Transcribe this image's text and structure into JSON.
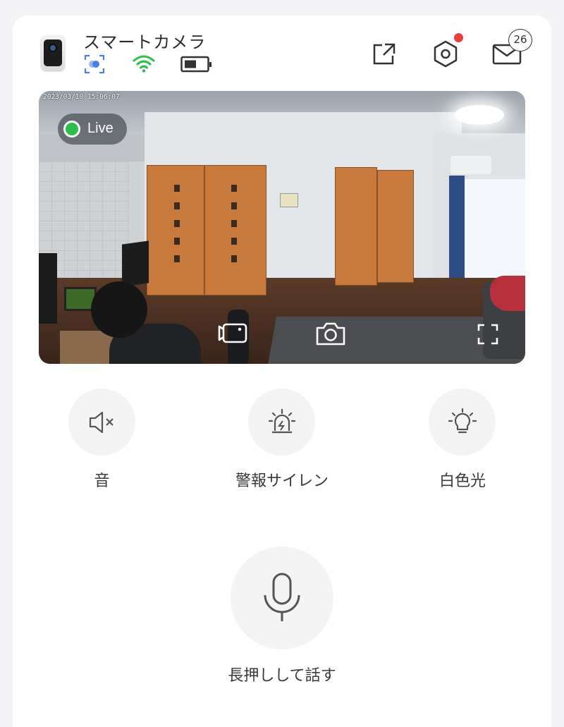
{
  "header": {
    "title": "スマートカメラ",
    "camera_icon": "camera-device-icon",
    "status_icons": [
      "motion-detect-icon",
      "wifi-icon",
      "battery-icon"
    ],
    "actions": [
      "share-icon",
      "settings-icon",
      "mail-icon"
    ],
    "settings_has_alert": true,
    "mail_count": "26"
  },
  "video": {
    "timestamp": "2023/03/10 15:06:07",
    "live_label": "Live",
    "controls": [
      "record-icon",
      "snapshot-icon",
      "fullscreen-icon"
    ]
  },
  "controls": [
    {
      "label": "音",
      "icon": "speaker-muted-icon"
    },
    {
      "label": "警報サイレン",
      "icon": "siren-icon"
    },
    {
      "label": "白色光",
      "icon": "light-bulb-icon"
    }
  ],
  "talk": {
    "label": "長押しして話す",
    "icon": "microphone-icon"
  },
  "colors": {
    "live_green": "#2bbf4a",
    "wifi_green": "#2bbf4a",
    "motion_blue": "#4a7fe0",
    "alert_red": "#e8413d"
  }
}
